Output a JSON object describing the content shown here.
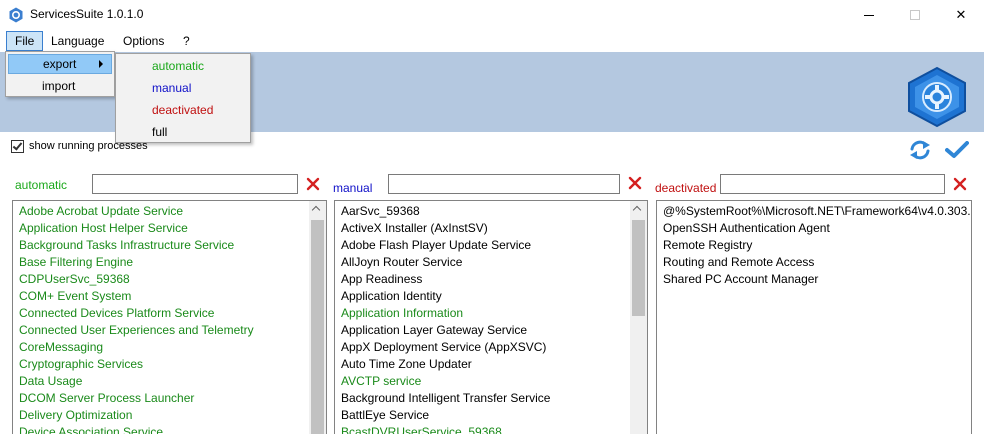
{
  "window": {
    "title": "ServicesSuite 1.0.1.0",
    "close_glyph": "✕"
  },
  "menu": {
    "file": "File",
    "language": "Language",
    "options": "Options",
    "help": "?"
  },
  "file_menu": {
    "export": "export",
    "import": "import"
  },
  "export_menu": {
    "automatic": "automatic",
    "manual": "manual",
    "deactivated": "deactivated",
    "full": "full"
  },
  "options": {
    "show_running_processes": "show running processes",
    "show_running_checked": true
  },
  "columns": {
    "automatic": {
      "label": "automatic",
      "search_value": "",
      "items": [
        "Adobe Acrobat Update Service",
        "Application Host Helper Service",
        "Background Tasks Infrastructure Service",
        "Base Filtering Engine",
        "CDPUserSvc_59368",
        "COM+ Event System",
        "Connected Devices Platform Service",
        "Connected User Experiences and Telemetry",
        "CoreMessaging",
        "Cryptographic Services",
        "Data Usage",
        "DCOM Server Process Launcher",
        "Delivery Optimization",
        "Device Association Service"
      ]
    },
    "manual": {
      "label": "manual",
      "search_value": "",
      "items": [
        {
          "name": "AarSvc_59368",
          "running": false
        },
        {
          "name": "ActiveX Installer (AxInstSV)",
          "running": false
        },
        {
          "name": "Adobe Flash Player Update Service",
          "running": false
        },
        {
          "name": "AllJoyn Router Service",
          "running": false
        },
        {
          "name": "App Readiness",
          "running": false
        },
        {
          "name": "Application Identity",
          "running": false
        },
        {
          "name": "Application Information",
          "running": true
        },
        {
          "name": "Application Layer Gateway Service",
          "running": false
        },
        {
          "name": "AppX Deployment Service (AppXSVC)",
          "running": false
        },
        {
          "name": "Auto Time Zone Updater",
          "running": false
        },
        {
          "name": "AVCTP service",
          "running": true
        },
        {
          "name": "Background Intelligent Transfer Service",
          "running": false
        },
        {
          "name": "BattlEye Service",
          "running": false
        },
        {
          "name": "BcastDVRUserService_59368",
          "running": true
        }
      ]
    },
    "deactivated": {
      "label": "deactivated",
      "search_value": "",
      "items": [
        "@%SystemRoot%\\Microsoft.NET\\Framework64\\v4.0.303...",
        "OpenSSH Authentication Agent",
        "Remote Registry",
        "Routing and Remote Access",
        "Shared PC Account Manager"
      ]
    }
  },
  "colors": {
    "automatic": "#1aa81a",
    "manual": "#1010c8",
    "deactivated": "#c01010",
    "running_text": "#1a8a1a",
    "header_band": "#b4c8e0"
  },
  "icons": {
    "app": "gear-hexagon-icon",
    "refresh": "refresh-icon",
    "apply": "checkmark-icon",
    "clear": "red-x-icon"
  }
}
